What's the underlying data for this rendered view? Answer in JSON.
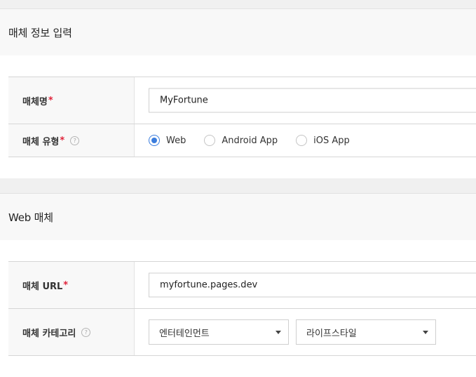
{
  "sections": [
    {
      "title": "매체 정보 입력",
      "fields": {
        "name": {
          "label": "매체명",
          "required": "*",
          "value": "MyFortune"
        },
        "type": {
          "label": "매체 유형",
          "required": "*",
          "help_icon": "?",
          "options": [
            "Web",
            "Android App",
            "iOS App"
          ],
          "selected": "Web"
        }
      }
    },
    {
      "title": "Web 매체",
      "fields": {
        "url": {
          "label": "매체 URL",
          "required": "*",
          "value": "myfortune.pages.dev"
        },
        "category": {
          "label": "매체 카테고리",
          "help_icon": "?",
          "primary": "엔터테인먼트",
          "secondary": "라이프스타일"
        }
      }
    }
  ],
  "colors": {
    "accent": "#3b7ddd",
    "required": "#e0233a",
    "label_bg": "#f8f8f8",
    "border": "#d6d6d6"
  }
}
